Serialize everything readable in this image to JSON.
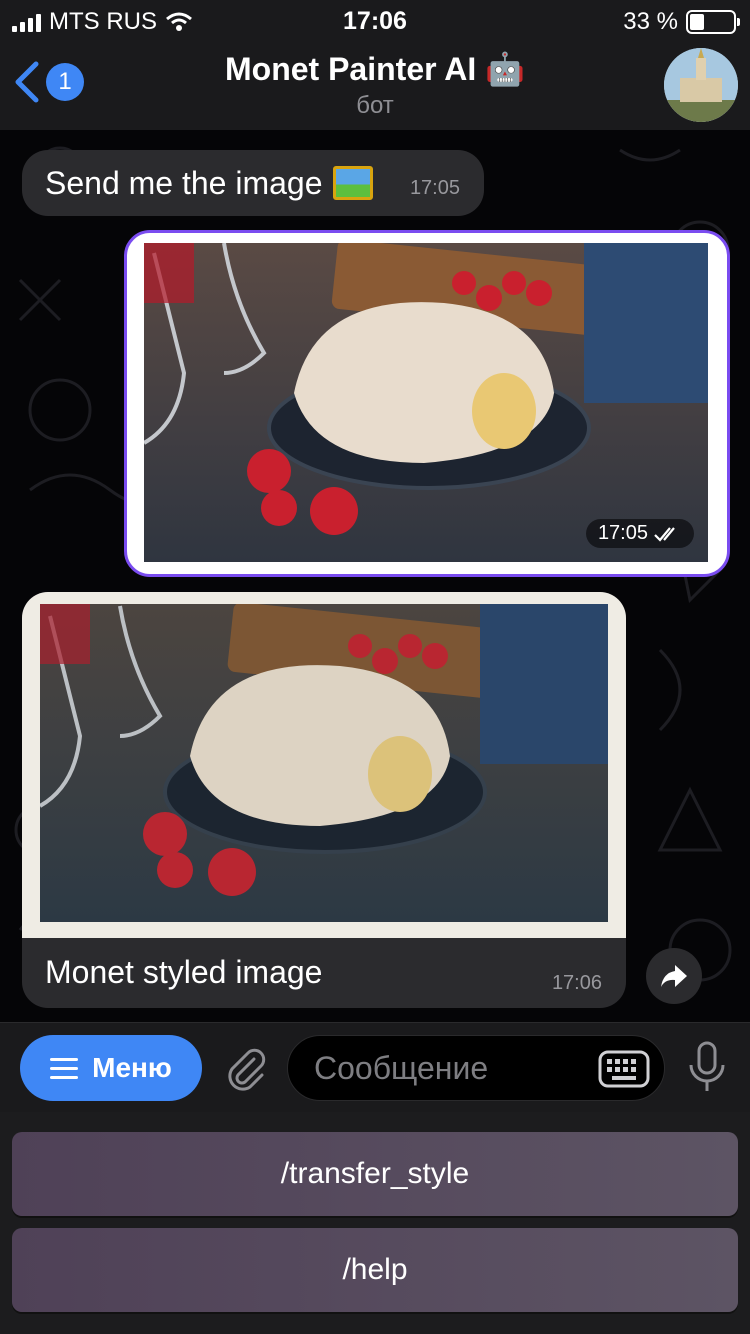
{
  "status_bar": {
    "carrier": "MTS RUS",
    "time": "17:06",
    "battery": "33 %",
    "battery_level": 0.33
  },
  "header": {
    "back_badge": "1",
    "title": "Monet Painter AI 🤖",
    "subtitle": "бот"
  },
  "messages": [
    {
      "type": "incoming-text",
      "text": "Send me the image",
      "time": "17:05"
    },
    {
      "type": "outgoing-photo",
      "time": "17:05",
      "status": "read"
    },
    {
      "type": "incoming-photo",
      "caption": "Monet styled image",
      "time": "17:06"
    }
  ],
  "composer": {
    "menu_label": "Меню",
    "placeholder": "Сообщение"
  },
  "bot_keyboard": {
    "buttons": [
      "/transfer_style",
      "/help"
    ]
  },
  "icons": {
    "back": "chevron-left-icon",
    "attach": "paperclip-icon",
    "keyboard": "keyboard-icon",
    "mic": "microphone-icon",
    "share": "share-arrow-icon",
    "read": "double-check-icon"
  },
  "colors": {
    "accent": "#3f87f5",
    "outgoing_border": "#7a4cf0",
    "bubble": "#2b2b2e",
    "bot_button": "#56495d"
  }
}
